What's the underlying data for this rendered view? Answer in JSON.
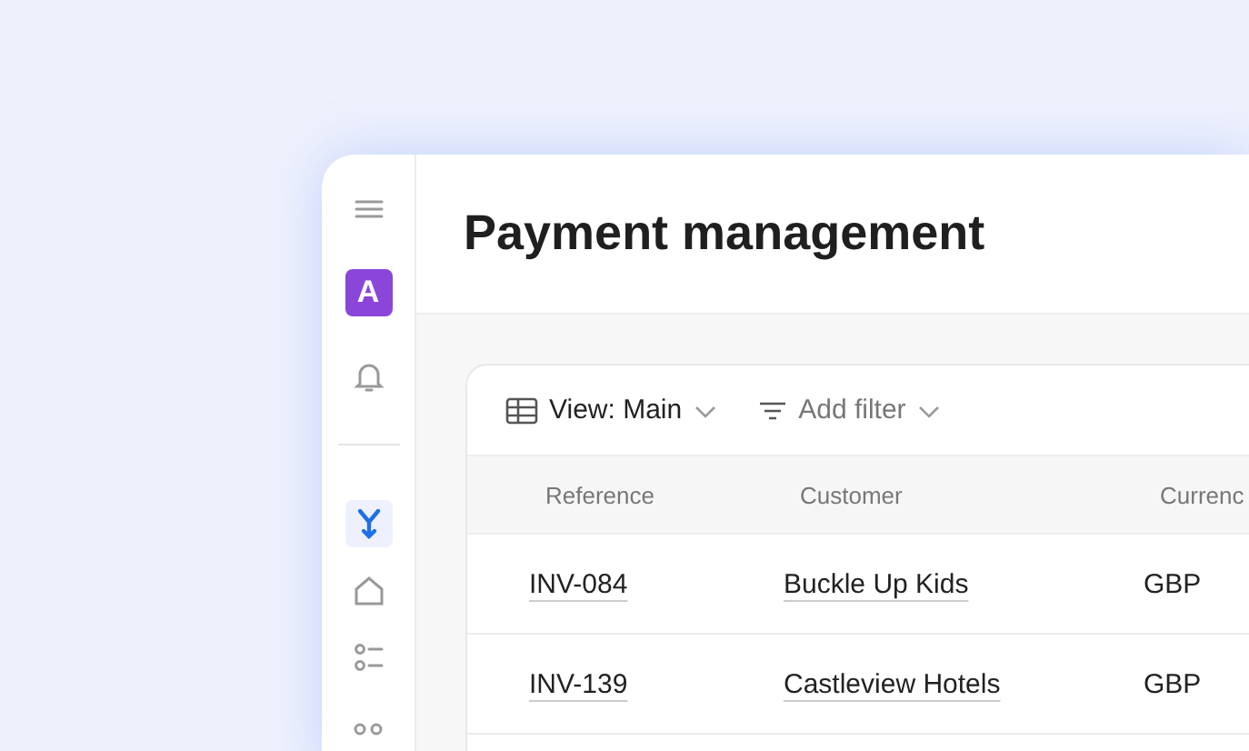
{
  "sidebar": {
    "top": [
      {
        "kind": "menu",
        "selected": false
      },
      {
        "kind": "avatar",
        "label": "A",
        "selected": false
      },
      {
        "kind": "bell",
        "selected": false
      }
    ],
    "items": [
      {
        "kind": "branch",
        "selected": true
      },
      {
        "kind": "home",
        "selected": false
      },
      {
        "kind": "checklist",
        "selected": false
      },
      {
        "kind": "circles",
        "selected": false
      }
    ]
  },
  "title": "Payment management",
  "toolbar": {
    "view": "View: Main",
    "filter": "Add filter"
  },
  "table": {
    "columns": [
      "Reference",
      "Customer",
      "Currenc"
    ],
    "rows": [
      [
        "INV-084",
        "Buckle Up Kids",
        "GBP"
      ],
      [
        "INV-139",
        "Castleview Hotels",
        "GBP"
      ]
    ]
  }
}
